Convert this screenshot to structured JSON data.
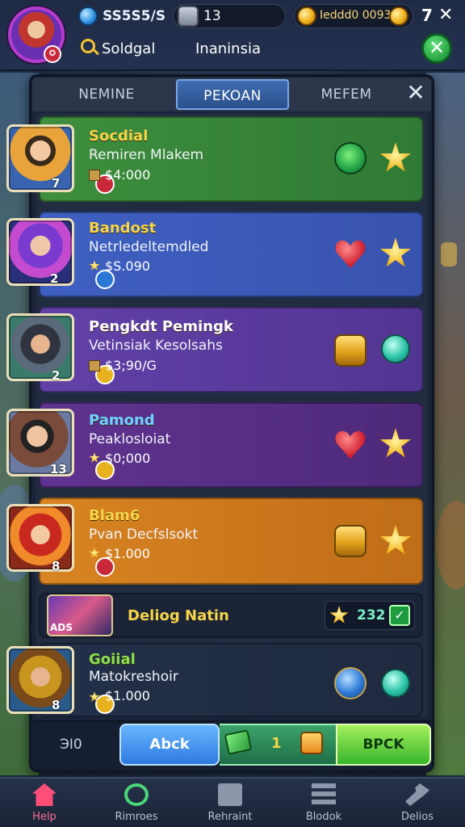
{
  "topbar": {
    "gems": "SS5S5/S",
    "level": "13",
    "gold": "Ieddd0 0093",
    "menu_button": "7",
    "search_label": "Soldgal",
    "region_label": "Inaninsia"
  },
  "tabs": [
    {
      "label": "NEMINE",
      "active": false
    },
    {
      "label": "PEKOAN",
      "active": true
    },
    {
      "label": "MEFEM",
      "active": false
    }
  ],
  "cards": [
    {
      "name": "Socdial",
      "desc": "Remiren Mlakem",
      "price": "$4:000",
      "portrait_num": "7",
      "icon_a": "green-star-orb-icon",
      "icon_b": "gold-star-icon",
      "color": "#3c8a3c"
    },
    {
      "name": "Bandost",
      "desc": "Netrledeltemdled",
      "price": "$S.090",
      "portrait_num": "2",
      "icon_a": "red-heart-icon",
      "icon_b": "gold-star-icon",
      "color": "#3b5ab8"
    },
    {
      "name": "Pengkdt Pemingk",
      "desc": "Vetinsiak Kesolsahs",
      "price": "$3;90/G",
      "portrait_num": "2",
      "icon_a": "gold-chest-icon",
      "icon_b": "teal-leaf-icon",
      "color": "#5a3a9a"
    },
    {
      "name": "Pamond",
      "desc": "Peaklosloiat",
      "price": "$0;000",
      "portrait_num": "13",
      "icon_a": "red-heart-icon",
      "icon_b": "gold-star-icon",
      "color": "#5c2f86"
    },
    {
      "name": "Blam6",
      "desc": "Pvan Decfslsokt",
      "price": "$1.000",
      "portrait_num": "8",
      "icon_a": "gold-chest-icon",
      "icon_b": "gold-star-icon",
      "color": "#cf7a1e"
    }
  ],
  "summary_row": {
    "portrait_label": "ADS",
    "title": "Deliog Natin",
    "value": "232",
    "check": "✓"
  },
  "last_card": {
    "name": "Goiial",
    "desc": "Matokreshoir",
    "price": "$1.000",
    "portrait_num": "8",
    "icon_a": "blue-orb-icon",
    "icon_b": "teal-leaf-icon"
  },
  "action_bar": {
    "left_label": "ЭI0",
    "blue_button": "Abck",
    "mid_value": "1",
    "green_button": "BPCK"
  },
  "bottom_nav": [
    {
      "label": "Help",
      "icon": "home-icon",
      "active": true
    },
    {
      "label": "Rimroes",
      "icon": "compass-icon",
      "active": false
    },
    {
      "label": "Rehraint",
      "icon": "inbox-icon",
      "active": false
    },
    {
      "label": "Blodok",
      "icon": "stack-icon",
      "active": false
    },
    {
      "label": "Delios",
      "icon": "hammer-icon",
      "active": false
    }
  ],
  "colors": {
    "gold_text": "#f6d54a",
    "panel": "#1a2338",
    "green_button": "#38b52c",
    "blue_button": "#2d7ae0"
  }
}
